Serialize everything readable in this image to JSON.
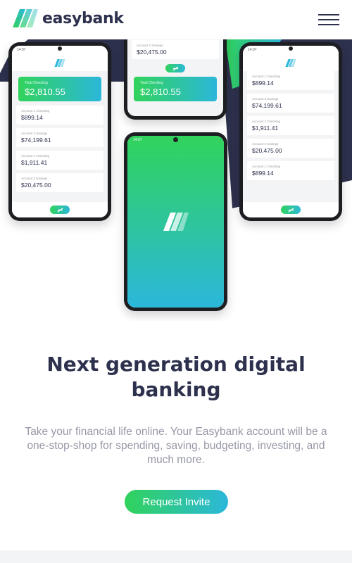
{
  "brand": {
    "name": "easybank"
  },
  "colors": {
    "navy": "#2d314d",
    "lime": "#31d35c",
    "cyan": "#2bb7da",
    "gray_text": "#9698a6",
    "light_bg": "#f3f4f6"
  },
  "icons": {
    "logo": "easybank-logo-icon",
    "menu": "hamburger-menu-icon",
    "fab": "transfer-icon"
  },
  "hero": {
    "phones": {
      "left": {
        "time": "14:07",
        "total": {
          "label": "Total Checking",
          "amount": "$2,810.55"
        },
        "accounts": [
          {
            "label": "Account 1 Checking",
            "amount": "$899.14"
          },
          {
            "label": "Account 2 Savings",
            "amount": "$74,199.61"
          },
          {
            "label": "Account 2 Checking",
            "amount": "$1,911.41"
          },
          {
            "label": "Account 2 Savings",
            "amount": "$20,475.00"
          }
        ]
      },
      "top_center": {
        "account": {
          "label": "Account 2 Savings",
          "amount": "$20,475.00"
        },
        "total": {
          "label": "Total Checking",
          "amount": "$2,810.55"
        }
      },
      "center": {
        "time": "14:07"
      },
      "right": {
        "time": "14:07",
        "accounts": [
          {
            "label": "Account 1 Checking",
            "amount": "$899.14"
          },
          {
            "label": "Account 2 Savings",
            "amount": "$74,199.61"
          },
          {
            "label": "Account 2 Checking",
            "amount": "$1,911.41"
          },
          {
            "label": "Account 2 Savings",
            "amount": "$20,475.00"
          },
          {
            "label": "Account 1 Checking",
            "amount": "$899.14"
          }
        ]
      }
    }
  },
  "content": {
    "headline_line1": "Next generation digital",
    "headline_line2": "banking",
    "description": "Take your financial life online. Your Easybank account will be a one-stop-shop for spending, saving, budgeting, investing, and much more.",
    "cta_label": "Request Invite"
  }
}
